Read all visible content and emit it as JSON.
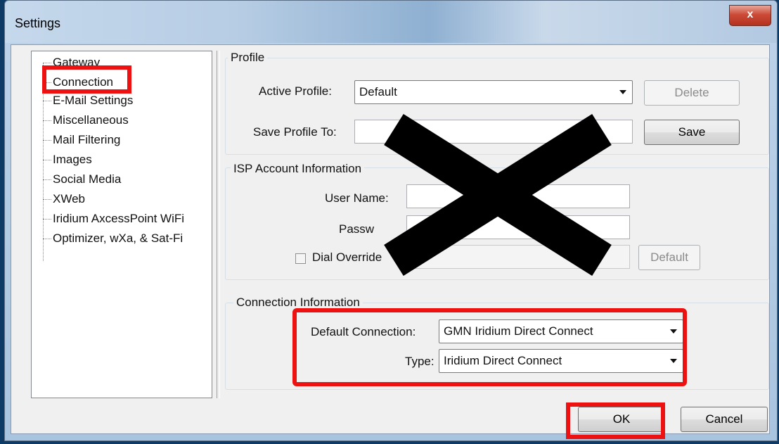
{
  "window": {
    "title": "Settings",
    "close_glyph": "x"
  },
  "tree": {
    "items": [
      "Gateway",
      "Connection",
      "E-Mail Settings",
      "Miscellaneous",
      "Mail Filtering",
      "Images",
      "Social Media",
      "XWeb",
      "Iridium AxcessPoint WiFi",
      "Optimizer, wXa, & Sat-Fi"
    ],
    "selected": "Connection"
  },
  "profile": {
    "group_label": "Profile",
    "active_profile_label": "Active Profile:",
    "active_profile_value": "Default",
    "delete_label": "Delete",
    "save_profile_label": "Save Profile To:",
    "save_profile_value": "",
    "save_label": "Save"
  },
  "isp": {
    "group_label": "ISP Account Information",
    "user_name_label": "User Name:",
    "user_name_value": "",
    "password_label": "Passw",
    "password_value": "",
    "dial_override_label": "Dial Override",
    "dial_override_checked": false,
    "dial_override_value": "",
    "default_label": "Default"
  },
  "connection": {
    "group_label": "Connection Information",
    "default_connection_label": "Default Connection:",
    "default_connection_value": "GMN Iridium Direct Connect",
    "type_label": "Type:",
    "type_value": "Iridium Direct Connect"
  },
  "footer": {
    "ok_label": "OK",
    "cancel_label": "Cancel"
  },
  "annotation_color": "#ee1111",
  "redaction_color": "#000000"
}
